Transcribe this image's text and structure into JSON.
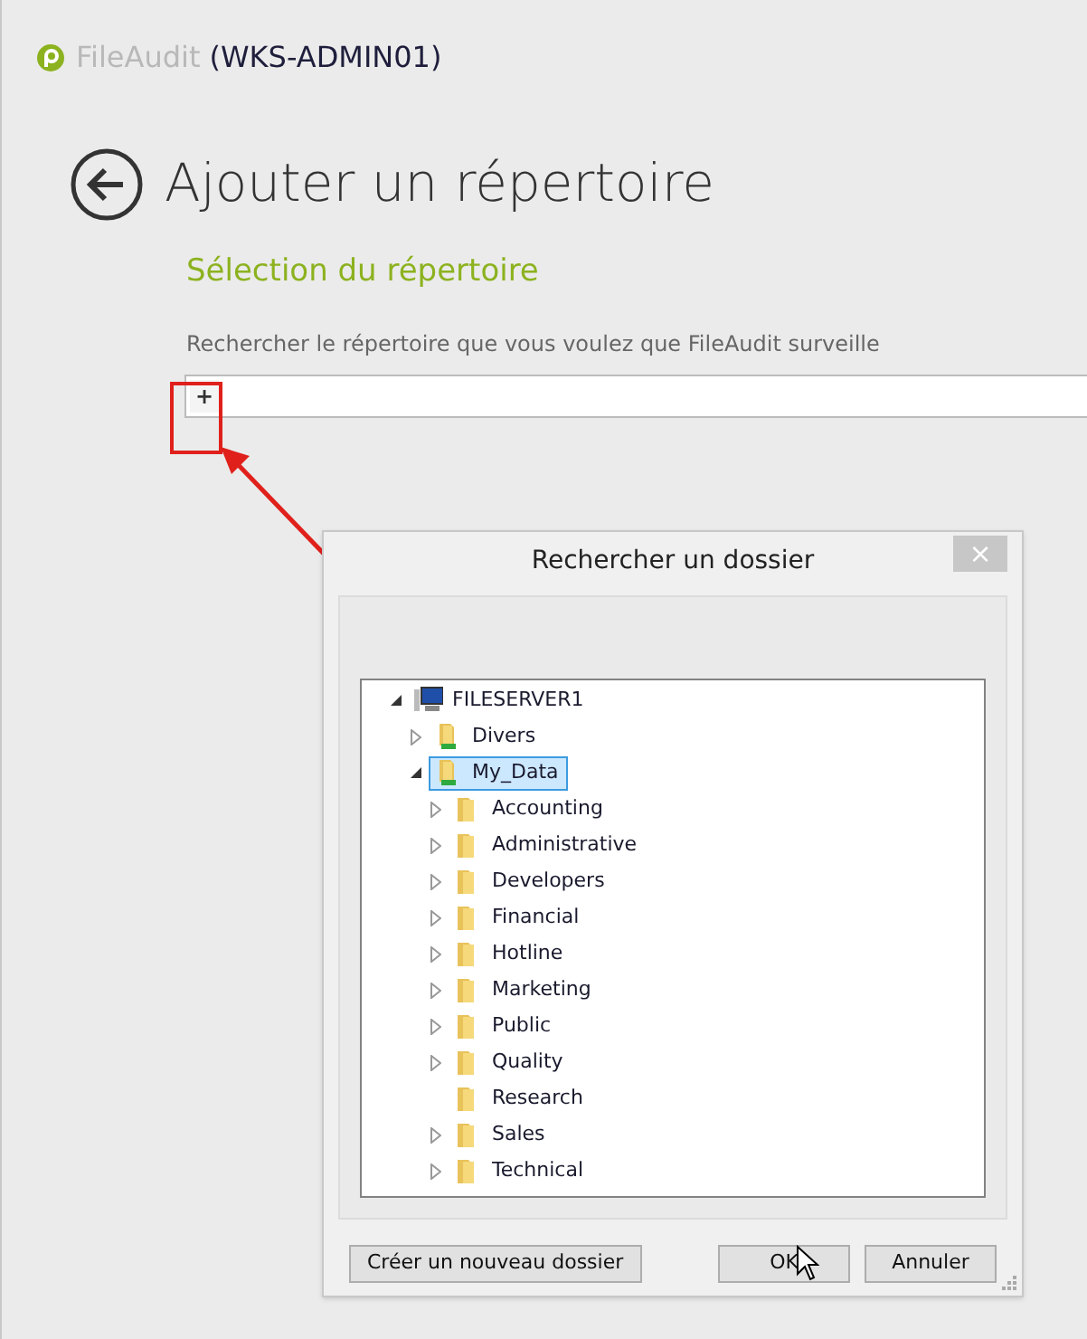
{
  "app": {
    "name": "FileAudit",
    "host": "(WKS-ADMIN01)"
  },
  "page": {
    "title": "Ajouter un répertoire",
    "section": "Sélection du répertoire",
    "hint": "Rechercher le répertoire que vous voulez que FileAudit surveille",
    "add_button": "+"
  },
  "dialog": {
    "title": "Rechercher un dossier",
    "close": "×",
    "tree": [
      {
        "label": "FILESERVER1",
        "kind": "computer",
        "expandable": true,
        "expanded": true,
        "selected": false,
        "children": [
          {
            "label": "Divers",
            "kind": "share",
            "expandable": true,
            "expanded": false,
            "selected": false
          },
          {
            "label": "My_Data",
            "kind": "share",
            "expandable": true,
            "expanded": true,
            "selected": true,
            "children": [
              {
                "label": "Accounting",
                "kind": "folder",
                "expandable": true,
                "expanded": false,
                "selected": false
              },
              {
                "label": "Administrative",
                "kind": "folder",
                "expandable": true,
                "expanded": false,
                "selected": false
              },
              {
                "label": "Developers",
                "kind": "folder",
                "expandable": true,
                "expanded": false,
                "selected": false
              },
              {
                "label": "Financial",
                "kind": "folder",
                "expandable": true,
                "expanded": false,
                "selected": false
              },
              {
                "label": "Hotline",
                "kind": "folder",
                "expandable": true,
                "expanded": false,
                "selected": false
              },
              {
                "label": "Marketing",
                "kind": "folder",
                "expandable": true,
                "expanded": false,
                "selected": false
              },
              {
                "label": "Public",
                "kind": "folder",
                "expandable": true,
                "expanded": false,
                "selected": false
              },
              {
                "label": "Quality",
                "kind": "folder",
                "expandable": true,
                "expanded": false,
                "selected": false
              },
              {
                "label": "Research",
                "kind": "folder",
                "expandable": false,
                "selected": false
              },
              {
                "label": "Sales",
                "kind": "folder",
                "expandable": true,
                "expanded": false,
                "selected": false
              },
              {
                "label": "Technical",
                "kind": "folder",
                "expandable": true,
                "expanded": false,
                "selected": false
              }
            ]
          }
        ]
      }
    ],
    "buttons": [
      {
        "label": "Créer un nouveau dossier",
        "kind": "left"
      },
      {
        "label": "OK",
        "kind": "right"
      },
      {
        "label": "Annuler",
        "kind": "right"
      }
    ]
  }
}
